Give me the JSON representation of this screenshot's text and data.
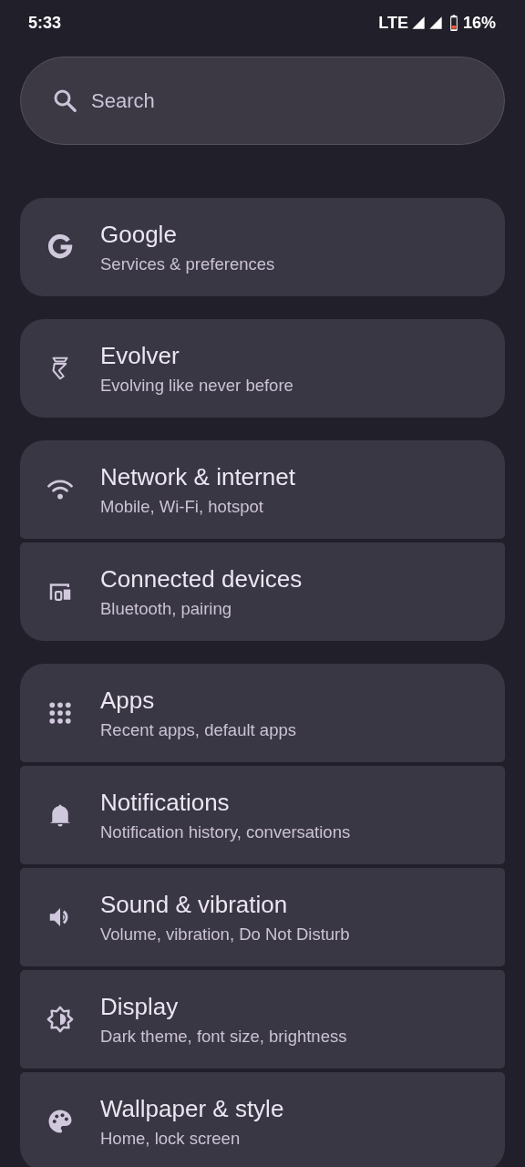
{
  "status_bar": {
    "time": "5:33",
    "network": "LTE",
    "battery": "16%"
  },
  "search": {
    "placeholder": "Search"
  },
  "groups": [
    {
      "items": [
        {
          "title": "Google",
          "subtitle": "Services & preferences"
        }
      ]
    },
    {
      "items": [
        {
          "title": "Evolver",
          "subtitle": "Evolving like never before"
        }
      ]
    },
    {
      "items": [
        {
          "title": "Network & internet",
          "subtitle": "Mobile, Wi-Fi, hotspot"
        },
        {
          "title": "Connected devices",
          "subtitle": "Bluetooth, pairing"
        }
      ]
    },
    {
      "items": [
        {
          "title": "Apps",
          "subtitle": "Recent apps, default apps"
        },
        {
          "title": "Notifications",
          "subtitle": "Notification history, conversations"
        },
        {
          "title": "Sound & vibration",
          "subtitle": "Volume, vibration, Do Not Disturb"
        },
        {
          "title": "Display",
          "subtitle": "Dark theme, font size, brightness"
        },
        {
          "title": "Wallpaper & style",
          "subtitle": "Home, lock screen"
        }
      ]
    }
  ]
}
